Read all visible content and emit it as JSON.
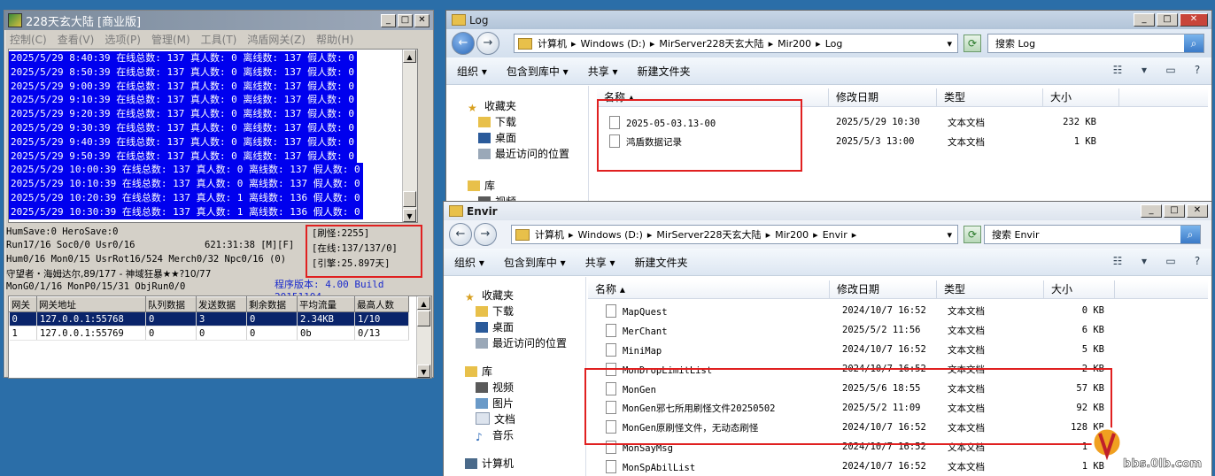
{
  "server": {
    "title": "228天玄大陆 [商业版]",
    "menu": [
      "控制(C)",
      "查看(V)",
      "选项(P)",
      "管理(M)",
      "工具(T)",
      "鸿盾网关(Z)",
      "帮助(H)"
    ],
    "log_lines": [
      "2025/5/29 8:40:39 在线总数: 137 真人数: 0 离线数: 137 假人数: 0",
      "2025/5/29 8:50:39 在线总数: 137 真人数: 0 离线数: 137 假人数: 0",
      "2025/5/29 9:00:39 在线总数: 137 真人数: 0 离线数: 137 假人数: 0",
      "2025/5/29 9:10:39 在线总数: 137 真人数: 0 离线数: 137 假人数: 0",
      "2025/5/29 9:20:39 在线总数: 137 真人数: 0 离线数: 137 假人数: 0",
      "2025/5/29 9:30:39 在线总数: 137 真人数: 0 离线数: 137 假人数: 0",
      "2025/5/29 9:40:39 在线总数: 137 真人数: 0 离线数: 137 假人数: 0",
      "2025/5/29 9:50:39 在线总数: 137 真人数: 0 离线数: 137 假人数: 0",
      "2025/5/29 10:00:39 在线总数: 137 真人数: 0 离线数: 137 假人数: 0",
      "2025/5/29 10:10:39 在线总数: 137 真人数: 0 离线数: 137 假人数: 0",
      "2025/5/29 10:20:39 在线总数: 137 真人数: 1 离线数: 136 假人数: 0",
      "2025/5/29 10:30:39 在线总数: 137 真人数: 1 离线数: 136 假人数: 0"
    ],
    "stat1": "HumSave:0 HeroSave:0",
    "stat2": "Run17/16 Soc0/0 Usr0/16",
    "stat2b": "621:31:38 [M][F]",
    "stat3": "Hum0/16 Mon0/15 UsrRot16/524 Merch0/32 Npc0/16 (0)",
    "stat4": "守望者・海姆达尔,89/177 - 神域狂暴★★?10/77",
    "stat5": "MonG0/1/16 MonP0/15/31 ObjRun0/0",
    "box": [
      "[刷怪:2255]",
      "[在线:137/137/0]",
      "[引擎:25.897天]"
    ],
    "version": "程序版本: 4.00 Build 20151104",
    "gw_headers": [
      "网关",
      "网关地址",
      "队列数据",
      "发送数据",
      "剩余数据",
      "平均流量",
      "最高人数"
    ],
    "gw_rows": [
      [
        "0",
        "127.0.0.1:55768",
        "0",
        "3",
        "0",
        "2.34KB",
        "1/10"
      ],
      [
        "1",
        "127.0.0.1:55769",
        "0",
        "0",
        "0",
        "0b",
        "0/13"
      ]
    ]
  },
  "log_win": {
    "title": "Log",
    "crumbs": [
      "计算机",
      "Windows (D:)",
      "MirServer228天玄大陆",
      "Mir200",
      "Log"
    ],
    "search": "搜索 Log",
    "toolbar": [
      "组织 ▾",
      "包含到库中 ▾",
      "共享 ▾",
      "新建文件夹"
    ],
    "nav": [
      "收藏夹",
      "下载",
      "桌面",
      "最近访问的位置",
      "库",
      "视频"
    ],
    "headers": [
      "名称",
      "修改日期",
      "类型",
      "大小"
    ],
    "files": [
      [
        "2025-05-03.13-00",
        "2025/5/29 10:30",
        "文本文档",
        "232 KB"
      ],
      [
        "鸿盾数据记录",
        "2025/5/3 13:00",
        "文本文档",
        "1 KB"
      ]
    ]
  },
  "envir_win": {
    "title": "Envir",
    "crumbs": [
      "计算机",
      "Windows (D:)",
      "MirServer228天玄大陆",
      "Mir200",
      "Envir"
    ],
    "search": "搜索 Envir",
    "toolbar": [
      "组织 ▾",
      "包含到库中 ▾",
      "共享 ▾",
      "新建文件夹"
    ],
    "nav": [
      "收藏夹",
      "下载",
      "桌面",
      "最近访问的位置",
      "库",
      "视频",
      "图片",
      "文档",
      "音乐",
      "计算机"
    ],
    "headers": [
      "名称",
      "修改日期",
      "类型",
      "大小"
    ],
    "files": [
      [
        "MapQuest",
        "2024/10/7 16:52",
        "文本文档",
        "0 KB"
      ],
      [
        "MerChant",
        "2025/5/2 11:56",
        "文本文档",
        "6 KB"
      ],
      [
        "MiniMap",
        "2024/10/7 16:52",
        "文本文档",
        "5 KB"
      ],
      [
        "MonDropLimitList",
        "2024/10/7 16:52",
        "文本文档",
        "2 KB"
      ],
      [
        "MonGen",
        "2025/5/6 18:55",
        "文本文档",
        "57 KB"
      ],
      [
        "MonGen邪七所用刷怪文件20250502",
        "2025/5/2 11:09",
        "文本文档",
        "92 KB"
      ],
      [
        "MonGen原刷怪文件，无动态刷怪",
        "2024/10/7 16:52",
        "文本文档",
        "128 KB"
      ],
      [
        "MonSayMsg",
        "2024/10/7 16:52",
        "文本文档",
        "1 KB"
      ],
      [
        "MonSpAbilList",
        "2024/10/7 16:52",
        "文本文档",
        "1 KB"
      ]
    ]
  },
  "watermark": {
    "main": "论坛",
    "site": "bbs.0lb.com"
  }
}
